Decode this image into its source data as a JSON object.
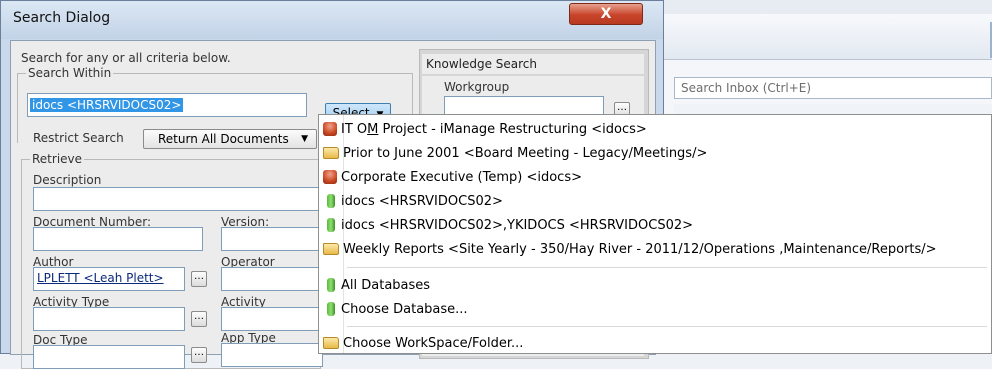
{
  "dialog": {
    "title": "Search Dialog",
    "close_label": "X",
    "instructions": "Search for any or all   criteria below.",
    "search_within": {
      "group_label": "Search Within",
      "value": "idocs <HRSRVIDOCS02>",
      "select_label": "Select"
    },
    "restrict": {
      "label": "Restrict Search",
      "value": "Return All Documents"
    },
    "retrieve": {
      "group_label": "Retrieve",
      "description_label": "Description",
      "document_number_label": "Document Number:",
      "version_label": "Version:",
      "author_label": "Author",
      "author_value": "LPLETT <Leah Plett>",
      "operator_label": "Operator",
      "activity_type_label": "Activity Type",
      "activity_label": "Activity",
      "doc_type_label": "Doc Type",
      "app_type_label": "App Type"
    },
    "knowledge": {
      "header": "Knowledge Search",
      "workgroup_label": "Workgroup"
    }
  },
  "menu": {
    "items": [
      {
        "icon": "database-red-icon",
        "pre": "IT O",
        "underlined": "M",
        "post": " Project - iManage Restructuring <idocs>"
      },
      {
        "icon": "folder-icon",
        "text": "Prior to June 2001 <Board Meeting - Legacy/Meetings/>"
      },
      {
        "icon": "database-red-icon",
        "text": "Corporate Executive (Temp) <idocs>"
      },
      {
        "icon": "database-green-icon",
        "text": "idocs <HRSRVIDOCS02>"
      },
      {
        "icon": "database-green-icon",
        "text": "idocs <HRSRVIDOCS02>,YKIDOCS <HRSRVIDOCS02>"
      },
      {
        "icon": "folder-icon",
        "text": "Weekly Reports <Site Yearly - 350/Hay River - 2011/12/Operations ,Maintenance/Reports/>"
      },
      {
        "icon": "database-green-icon",
        "text": "All Databases"
      },
      {
        "icon": "database-green-icon",
        "text": "Choose Database..."
      },
      {
        "icon": "folder-icon",
        "text": "Choose WorkSpace/Folder..."
      }
    ]
  },
  "background_app": {
    "search_placeholder": "Search Inbox (Ctrl+E)"
  }
}
